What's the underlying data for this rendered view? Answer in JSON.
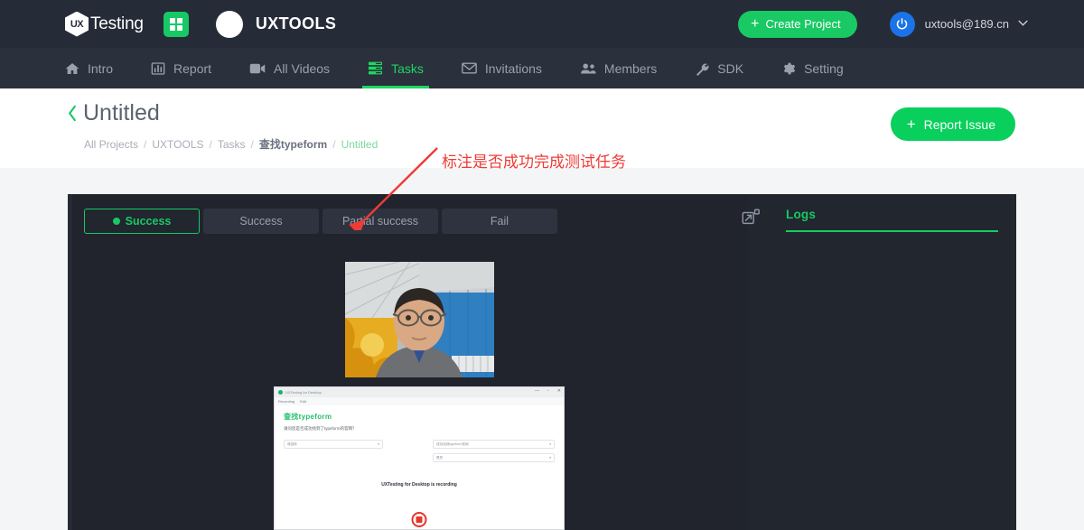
{
  "header": {
    "logo_mark": "UX",
    "logo_word": "Testing",
    "grid_icon": "grid-apps-icon",
    "org_name": "UXTOOLS",
    "create_project_label": "Create Project",
    "create_plus": "+",
    "user_email": "uxtools@189.cn",
    "caret_glyph": "∨",
    "power_glyph": "⏻",
    "accent_green": "#18c964",
    "bar_color": "#262b38"
  },
  "nav": {
    "items": [
      {
        "label": "Intro",
        "icon": "home-icon",
        "active": false
      },
      {
        "label": "Report",
        "icon": "bar-chart-icon",
        "active": false
      },
      {
        "label": "All Videos",
        "icon": "video-camera-icon",
        "active": false
      },
      {
        "label": "Tasks",
        "icon": "tasks-list-icon",
        "active": true
      },
      {
        "label": "Invitations",
        "icon": "envelope-icon",
        "active": false
      },
      {
        "label": "Members",
        "icon": "people-icon",
        "active": false
      },
      {
        "label": "SDK",
        "icon": "wrench-icon",
        "active": false
      },
      {
        "label": "Setting",
        "icon": "gear-icon",
        "active": false
      }
    ],
    "active_color": "#1ed760"
  },
  "page": {
    "back_chevron": "‹",
    "title": "Untitled",
    "breadcrumb": [
      {
        "label": "All Projects",
        "current": false,
        "bold": false
      },
      {
        "label": "UXTOOLS",
        "current": false,
        "bold": false
      },
      {
        "label": "Tasks",
        "current": false,
        "bold": false
      },
      {
        "label": "查找typeform",
        "current": false,
        "bold": true
      },
      {
        "label": "Untitled",
        "current": true,
        "bold": false
      }
    ],
    "separator": "/",
    "report_issue_label": "Report Issue",
    "report_issue_plus": "+"
  },
  "annotation": {
    "text": "标注是否成功完成测试任务",
    "color": "#ee3b36"
  },
  "content": {
    "status_buttons": [
      {
        "label": "Success",
        "selected": true,
        "has_dot": true
      },
      {
        "label": "Success",
        "selected": false,
        "has_dot": false
      },
      {
        "label": "Partial success",
        "selected": false,
        "has_dot": false
      },
      {
        "label": "Fail",
        "selected": false,
        "has_dot": false
      }
    ],
    "expand_icon": "expand-window-icon",
    "logs_tab_label": "Logs",
    "webcam_name": "webcam-video-thumbnail",
    "screen_recording_name": "screen-recording-thumbnail",
    "recording_overlay": {
      "window_title": "UXTesting for Desktop",
      "menu": [
        "Recording",
        "Edit"
      ],
      "page_heading": "查找typeform",
      "page_question": "请问您是否成功找到了typeform的官网？",
      "field_left": "请选择",
      "field_right_1": "成功找到typeform官网",
      "field_right_2": "是的",
      "recording_text": "UXTesting for Desktop is recording",
      "stop_button": "stop-recording-button"
    }
  }
}
